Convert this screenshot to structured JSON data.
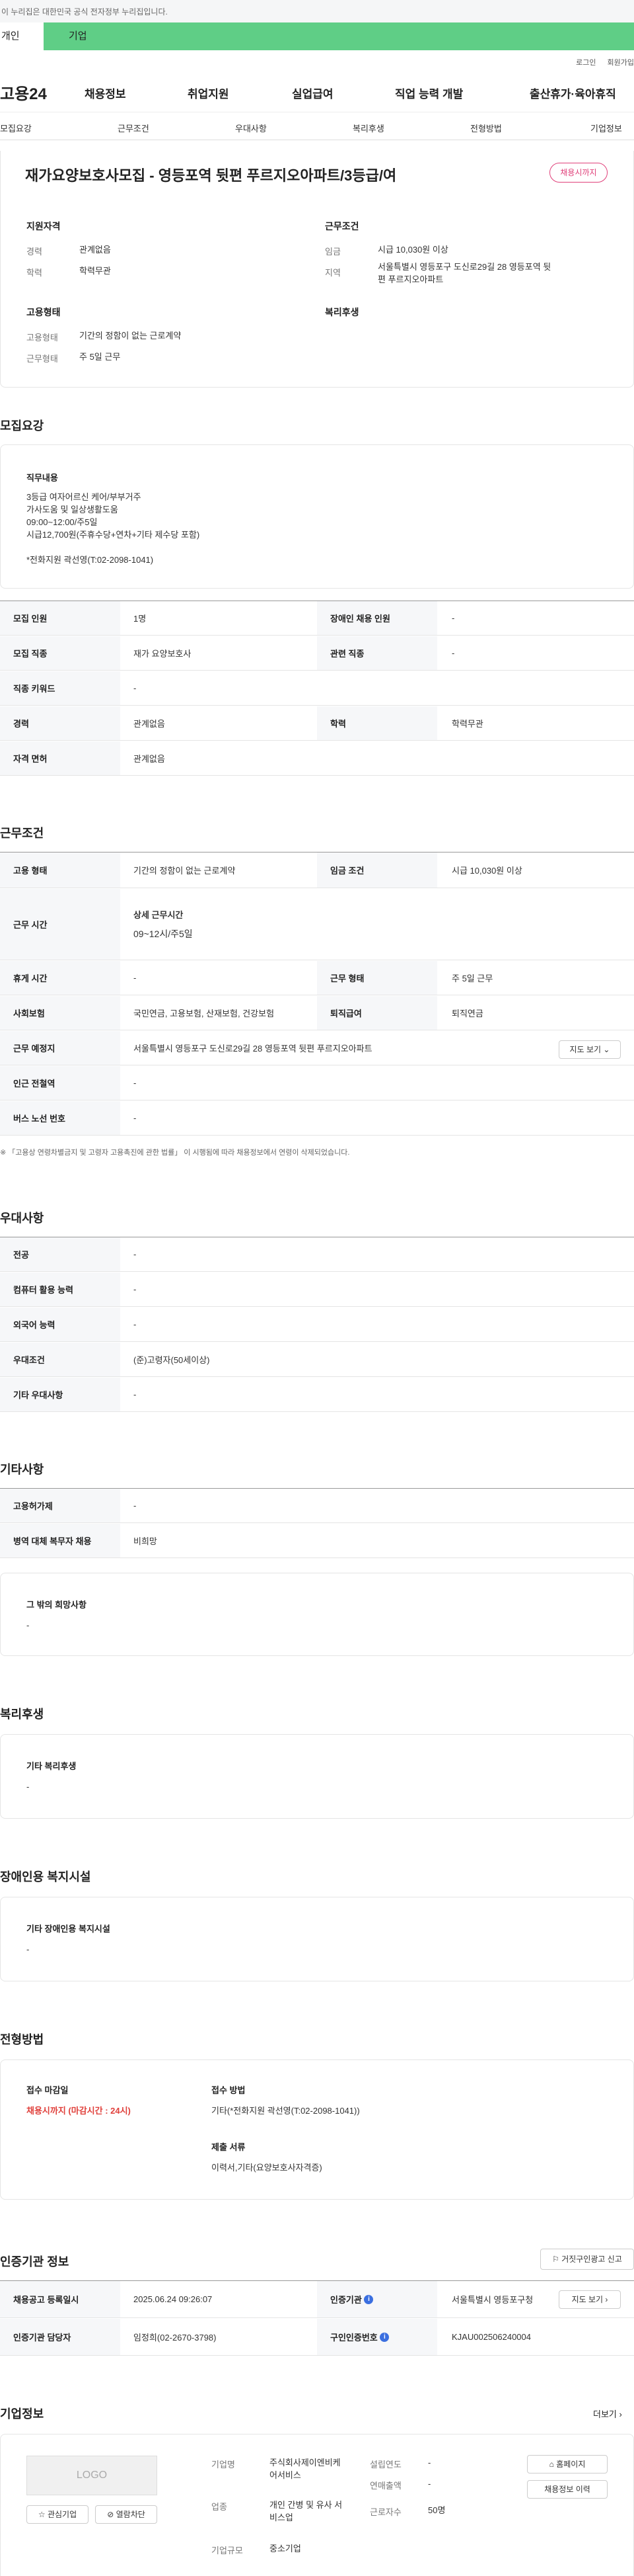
{
  "gov_banner": "이 누리집은 대한민국 공식 전자정부 누리집입니다.",
  "user_tabs": [
    "개인",
    "기업"
  ],
  "util_links": [
    "로그인",
    "회원가입"
  ],
  "site_logo": "고용24",
  "gnb": [
    "채용정보",
    "취업지원",
    "실업급여",
    "직업 능력 개발",
    "출산휴가·육아휴직"
  ],
  "anchor_tabs": [
    "모집요강",
    "근무조건",
    "우대사항",
    "복리후생",
    "전형방법",
    "기업정보"
  ],
  "job_title": "재가요양보호사모집 - 영등포역 뒷편 푸르지오아파트/3등급/여",
  "status_badge": "채용시까지",
  "summary": {
    "qual_title": "지원자격",
    "career_label": "경력",
    "career_value": "관계없음",
    "edu_label": "학력",
    "edu_value": "학력무관",
    "cond_title": "근무조건",
    "wage_label": "임금",
    "wage_value": "시급 10,030원 이상",
    "region_label": "지역",
    "region_value": "서울특별시 영등포구 도신로29길 28 영등포역 뒷편 푸르지오아파트",
    "emp_title": "고용형태",
    "emptype_label": "고용형태",
    "emptype_value": "기간의 정함이 없는 근로계약",
    "workform_label": "근무형태",
    "workform_value": "주 5일 근무",
    "welfare_title": "복리후생"
  },
  "recruit": {
    "section_title": "모집요강",
    "job_desc_title": "직무내용",
    "job_desc_lines": [
      "3등급 여자어르신 케어/부부거주",
      "가사도움 및 일상생활도움",
      "09:00~12:00/주5일",
      "시급12,700원(주휴수당+연차+기타 제수당 포함)",
      "",
      "*전화지원 곽선영(T:02-2098-1041)"
    ],
    "rows": [
      {
        "h1": "모집 인원",
        "v1": "1명",
        "h2": "장애인 채용 인원",
        "v2": "-"
      },
      {
        "h1": "모집 직종",
        "v1": "재가 요양보호사",
        "h2": "관련 직종",
        "v2": "-"
      },
      {
        "h1": "직종 키워드",
        "v1": "-"
      },
      {
        "h1": "경력",
        "v1": "관계없음",
        "h2": "학력",
        "v2": "학력무관"
      },
      {
        "h1": "자격 면허",
        "v1": "관계없음"
      }
    ]
  },
  "work": {
    "section_title": "근무조건",
    "emptype_h": "고용 형태",
    "emptype_v": "기간의 정함이 없는 근로계약",
    "wage_h": "임금 조건",
    "wage_v": "시급 10,030원 이상",
    "time_h": "근무 시간",
    "time_sub": "상세 근무시간",
    "time_v": "09~12시/주5일",
    "rest_h": "휴게 시간",
    "rest_v": "-",
    "form_h": "근무 형태",
    "form_v": "주 5일 근무",
    "ins_h": "사회보험",
    "ins_v": "국민연금, 고용보험, 산재보험, 건강보험",
    "sev_h": "퇴직급여",
    "sev_v": "퇴직연금",
    "place_h": "근무 예정지",
    "place_v": "서울특별시 영등포구 도신로29길 28 영등포역 뒷편 푸르지오아파트",
    "map_btn": "지도 보기",
    "subway_h": "인근 전철역",
    "subway_v": "-",
    "bus_h": "버스 노선 번호",
    "bus_v": "-",
    "notice": "「고용상 연령차별금지 및 고령자 고용촉진에 관한 법률」 이 시행됨에 따라 채용정보에서 연령이 삭제되었습니다."
  },
  "pref": {
    "section_title": "우대사항",
    "rows": [
      {
        "h": "전공",
        "v": "-"
      },
      {
        "h": "컴퓨터 활용 능력",
        "v": "-"
      },
      {
        "h": "외국어 능력",
        "v": "-"
      },
      {
        "h": "우대조건",
        "v": "(준)고령자(50세이상)"
      },
      {
        "h": "기타 우대사항",
        "v": "-"
      }
    ]
  },
  "etc": {
    "section_title": "기타사항",
    "rows": [
      {
        "h": "고용허가제",
        "v": "-"
      },
      {
        "h": "병역 대체 복무자 채용",
        "v": "비희망"
      }
    ],
    "other_title": "그 밖의 희망사항",
    "other_value": "-"
  },
  "welfare": {
    "section_title": "복리후생",
    "card_title": "기타 복리후생",
    "card_value": "-"
  },
  "disability": {
    "section_title": "장애인용 복지시설",
    "card_title": "기타 장애인용 복지시설",
    "card_value": "-"
  },
  "selection": {
    "section_title": "전형방법",
    "deadline_title": "접수 마감일",
    "deadline_value": "채용시까지 (마감시간 : 24시)",
    "method_title": "접수 방법",
    "method_value": "기타(*전화지원 곽선영(T:02-2098-1041))",
    "docs_title": "제출 서류",
    "docs_value": "이력서,기타(요양보호사자격증)"
  },
  "cert": {
    "section_title": "인증기관 정보",
    "report_btn": "거짓구인광고 신고",
    "date_h": "채용공고 등록일시",
    "date_v": "2025.06.24 09:26:07",
    "agency_h": "인증기관",
    "agency_v": "서울특별시 영등포구청",
    "manager_h": "인증기관 담당자",
    "manager_v": "임정희(02-2670-3798)",
    "no_h": "구인인증번호",
    "no_v": "KJAU002506240004",
    "gov_btn": "지도 보기"
  },
  "company": {
    "section_title": "기업정보",
    "more": "더보기",
    "logo_text": "LOGO",
    "interest_btn": "관심기업",
    "block_btn": "열람차단",
    "name_label": "기업명",
    "name_value": "주식회사제이엔비케어서비스",
    "industry_label": "업종",
    "industry_value": "개인 간병 및 유사 서비스업",
    "scale_label": "기업규모",
    "scale_value": "중소기업",
    "year_label": "설립연도",
    "year_value": "-",
    "sales_label": "연매출액",
    "sales_value": "-",
    "staff_label": "근로자수",
    "staff_value": "50명",
    "home_btn": "홈페이지",
    "recruit_btn": "채용정보 이력"
  }
}
